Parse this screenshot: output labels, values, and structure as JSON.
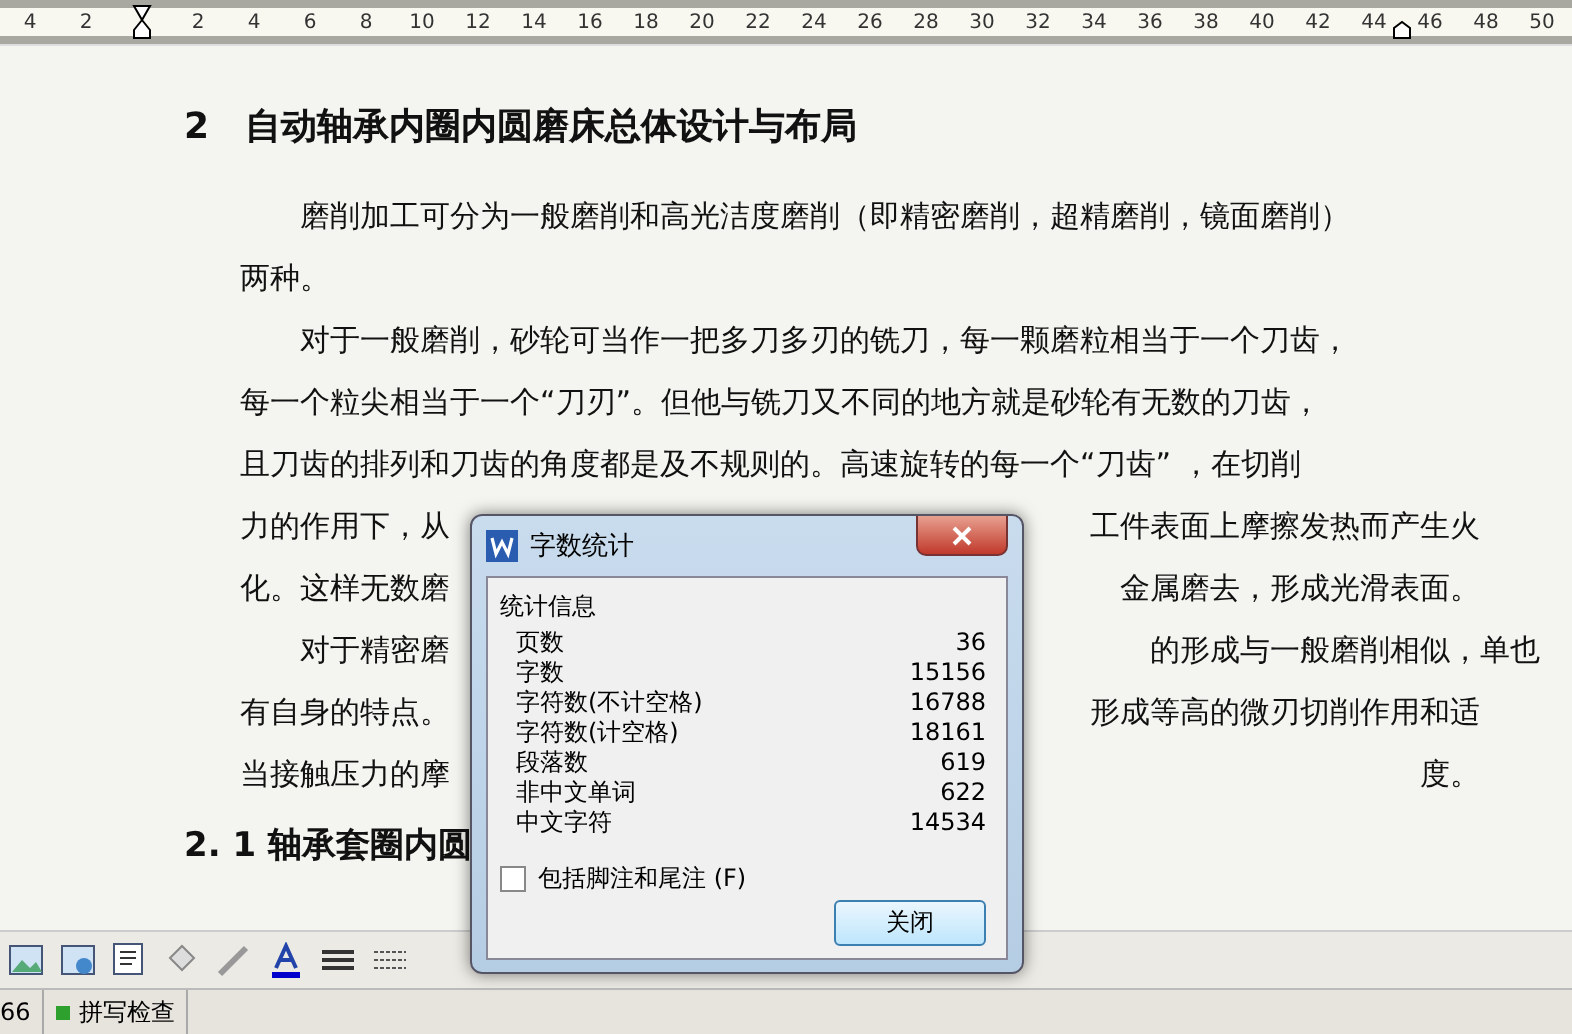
{
  "ruler": {
    "ticks": [
      "4",
      "2",
      "2",
      "4",
      "6",
      "8",
      "10",
      "12",
      "14",
      "16",
      "18",
      "20",
      "22",
      "24",
      "26",
      "28",
      "30",
      "32",
      "34",
      "36",
      "38",
      "40",
      "42",
      "44",
      "46",
      "48",
      "50"
    ]
  },
  "document": {
    "heading": "2　自动轴承内圈内圆磨床总体设计与布局",
    "lines": [
      {
        "indent": true,
        "segments": [
          "磨削加工可分为一般磨削和高光洁度磨削（即精密磨削，超精磨削，镜面磨削）"
        ]
      },
      {
        "indent": false,
        "segments": [
          "两种。"
        ]
      },
      {
        "indent": true,
        "segments": [
          "对于一般磨削，砂轮可当作一把多刀多刃的铣刀，每一颗磨粒相当于一个刀齿，"
        ]
      },
      {
        "indent": false,
        "segments": [
          "每一个粒尖相当于一个“刀刃”。但他与铣刀又不同的地方就是砂轮有无数的刀齿，"
        ]
      },
      {
        "indent": false,
        "segments": [
          "且刀齿的排列和刀齿的角度都是及不规则的。高速旋转的每一个“刀齿” ，在切削"
        ]
      },
      {
        "indent": false,
        "segments": [
          "力的作用下，从",
          "工件表面上摩擦发热而产生火"
        ]
      },
      {
        "indent": false,
        "segments": [
          "化。这样无数磨",
          "金属磨去，形成光滑表面。"
        ]
      },
      {
        "indent": true,
        "segments": [
          "对于精密磨",
          "的形成与一般磨削相似，单也"
        ]
      },
      {
        "indent": false,
        "segments": [
          "有自身的特点。",
          "形成等高的微刃切削作用和适"
        ]
      },
      {
        "indent": false,
        "segments": [
          "当接触压力的摩",
          "度。"
        ]
      }
    ],
    "subheading": "2. 1 轴承套圈内圆"
  },
  "dialog": {
    "title": "字数统计",
    "group": "统计信息",
    "stats": [
      {
        "label": "页数",
        "value": "36"
      },
      {
        "label": "字数",
        "value": "15156"
      },
      {
        "label": "字符数(不计空格)",
        "value": "16788"
      },
      {
        "label": "字符数(计空格)",
        "value": "18161"
      },
      {
        "label": "段落数",
        "value": "619"
      },
      {
        "label": "非中文单词",
        "value": "622"
      },
      {
        "label": "中文字符",
        "value": "14534"
      }
    ],
    "include_notes": {
      "label": "包括脚注和尾注 (F)",
      "checked": false
    },
    "close_button": "关闭"
  },
  "status_bar": {
    "page_fragment": "66",
    "spell_check": "拼写检查"
  }
}
